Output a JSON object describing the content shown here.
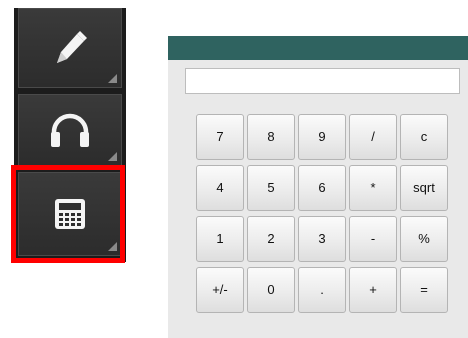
{
  "toolbar": {
    "tools": [
      {
        "name": "pencil",
        "icon": "pencil-icon"
      },
      {
        "name": "headphones",
        "icon": "headphones-icon"
      },
      {
        "name": "calculator",
        "icon": "calculator-icon",
        "selected": true
      }
    ],
    "selection_color": "#ff0000"
  },
  "calculator": {
    "titlebar_color": "#2f6360",
    "display_value": "",
    "keys": [
      [
        "7",
        "8",
        "9",
        "/",
        "c"
      ],
      [
        "4",
        "5",
        "6",
        "*",
        "sqrt"
      ],
      [
        "1",
        "2",
        "3",
        "-",
        "%"
      ],
      [
        "+/-",
        "0",
        ".",
        "+",
        "="
      ]
    ]
  }
}
